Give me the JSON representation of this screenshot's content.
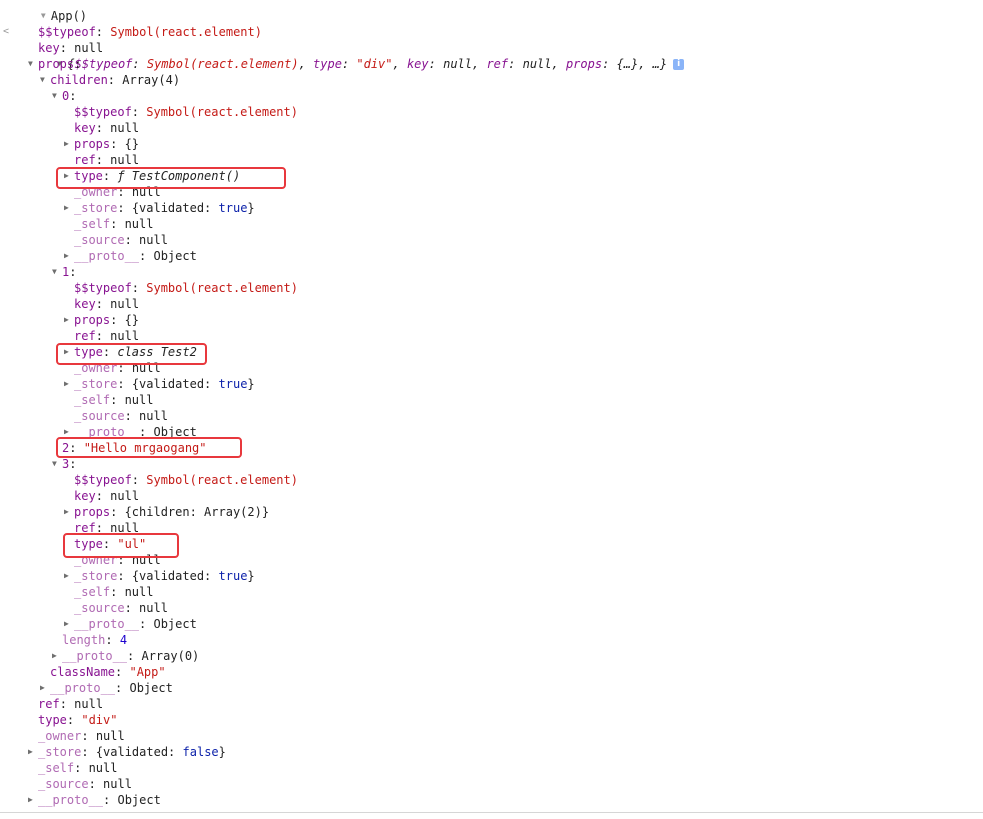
{
  "console": {
    "header_text": "App()",
    "summary": {
      "open": "{",
      "k1": "$$typeof",
      "v1": "Symbol(react.element)",
      "k2": "type",
      "v2": "\"div\"",
      "k3": "key",
      "v3": "null",
      "k4": "ref",
      "v4": "null",
      "k5": "props",
      "v5": "{…}",
      "tail": "…}"
    },
    "rows": [
      {
        "indent": 38,
        "tri": "",
        "k": "$$typeof",
        "parts": [
          {
            "c": "sym",
            "t": "Symbol(react.element)"
          }
        ]
      },
      {
        "indent": 38,
        "tri": "",
        "k": "key",
        "parts": [
          {
            "c": "plain",
            "t": "null"
          }
        ]
      },
      {
        "indent": 28,
        "tri": "down",
        "k": "props",
        "parts": []
      },
      {
        "indent": 40,
        "tri": "down",
        "k": "children",
        "parts": [
          {
            "c": "plain",
            "t": "Array(4)"
          }
        ]
      },
      {
        "indent": 52,
        "tri": "down",
        "k": "0",
        "parts": []
      },
      {
        "indent": 74,
        "tri": "",
        "k": "$$typeof",
        "parts": [
          {
            "c": "sym",
            "t": "Symbol(react.element)"
          }
        ]
      },
      {
        "indent": 74,
        "tri": "",
        "k": "key",
        "parts": [
          {
            "c": "plain",
            "t": "null"
          }
        ]
      },
      {
        "indent": 64,
        "tri": "right",
        "k": "props",
        "parts": [
          {
            "c": "plain",
            "t": "{}"
          }
        ]
      },
      {
        "indent": 74,
        "tri": "",
        "k": "ref",
        "parts": [
          {
            "c": "plain",
            "t": "null"
          }
        ]
      },
      {
        "indent": 64,
        "tri": "right",
        "k": "type",
        "parts": [
          {
            "c": "it",
            "t": "ƒ TestComponent()"
          }
        ]
      },
      {
        "indent": 74,
        "tri": "",
        "k": "_owner",
        "dim": true,
        "parts": [
          {
            "c": "plain",
            "t": "null"
          }
        ]
      },
      {
        "indent": 64,
        "tri": "right",
        "k": "_store",
        "dim": true,
        "parts": [
          {
            "c": "plain",
            "t": "{validated: "
          },
          {
            "c": "kw",
            "t": "true"
          },
          {
            "c": "plain",
            "t": "}"
          }
        ]
      },
      {
        "indent": 74,
        "tri": "",
        "k": "_self",
        "dim": true,
        "parts": [
          {
            "c": "plain",
            "t": "null"
          }
        ]
      },
      {
        "indent": 74,
        "tri": "",
        "k": "_source",
        "dim": true,
        "parts": [
          {
            "c": "plain",
            "t": "null"
          }
        ]
      },
      {
        "indent": 64,
        "tri": "right",
        "k": "__proto__",
        "dim": true,
        "parts": [
          {
            "c": "plain",
            "t": "Object"
          }
        ]
      },
      {
        "indent": 52,
        "tri": "down",
        "k": "1",
        "parts": []
      },
      {
        "indent": 74,
        "tri": "",
        "k": "$$typeof",
        "parts": [
          {
            "c": "sym",
            "t": "Symbol(react.element)"
          }
        ]
      },
      {
        "indent": 74,
        "tri": "",
        "k": "key",
        "parts": [
          {
            "c": "plain",
            "t": "null"
          }
        ]
      },
      {
        "indent": 64,
        "tri": "right",
        "k": "props",
        "parts": [
          {
            "c": "plain",
            "t": "{}"
          }
        ]
      },
      {
        "indent": 74,
        "tri": "",
        "k": "ref",
        "parts": [
          {
            "c": "plain",
            "t": "null"
          }
        ]
      },
      {
        "indent": 64,
        "tri": "right",
        "k": "type",
        "parts": [
          {
            "c": "it",
            "t": "class Test2"
          }
        ]
      },
      {
        "indent": 74,
        "tri": "",
        "k": "_owner",
        "dim": true,
        "parts": [
          {
            "c": "plain",
            "t": "null"
          }
        ]
      },
      {
        "indent": 64,
        "tri": "right",
        "k": "_store",
        "dim": true,
        "parts": [
          {
            "c": "plain",
            "t": "{validated: "
          },
          {
            "c": "kw",
            "t": "true"
          },
          {
            "c": "plain",
            "t": "}"
          }
        ]
      },
      {
        "indent": 74,
        "tri": "",
        "k": "_self",
        "dim": true,
        "parts": [
          {
            "c": "plain",
            "t": "null"
          }
        ]
      },
      {
        "indent": 74,
        "tri": "",
        "k": "_source",
        "dim": true,
        "parts": [
          {
            "c": "plain",
            "t": "null"
          }
        ]
      },
      {
        "indent": 64,
        "tri": "right",
        "k": "__proto__",
        "dim": true,
        "parts": [
          {
            "c": "plain",
            "t": "Object"
          }
        ]
      },
      {
        "indent": 62,
        "tri": "",
        "k": "2",
        "parts": [
          {
            "c": "str",
            "t": "\"Hello mrgaogang\""
          }
        ]
      },
      {
        "indent": 52,
        "tri": "down",
        "k": "3",
        "parts": []
      },
      {
        "indent": 74,
        "tri": "",
        "k": "$$typeof",
        "parts": [
          {
            "c": "sym",
            "t": "Symbol(react.element)"
          }
        ]
      },
      {
        "indent": 74,
        "tri": "",
        "k": "key",
        "parts": [
          {
            "c": "plain",
            "t": "null"
          }
        ]
      },
      {
        "indent": 64,
        "tri": "right",
        "k": "props",
        "parts": [
          {
            "c": "plain",
            "t": "{children: Array(2)}"
          }
        ]
      },
      {
        "indent": 74,
        "tri": "",
        "k": "ref",
        "parts": [
          {
            "c": "plain",
            "t": "null"
          }
        ]
      },
      {
        "indent": 74,
        "tri": "",
        "k": "type",
        "parts": [
          {
            "c": "str",
            "t": "\"ul\""
          }
        ]
      },
      {
        "indent": 74,
        "tri": "",
        "k": "_owner",
        "dim": true,
        "parts": [
          {
            "c": "plain",
            "t": "null"
          }
        ]
      },
      {
        "indent": 64,
        "tri": "right",
        "k": "_store",
        "dim": true,
        "parts": [
          {
            "c": "plain",
            "t": "{validated: "
          },
          {
            "c": "kw",
            "t": "true"
          },
          {
            "c": "plain",
            "t": "}"
          }
        ]
      },
      {
        "indent": 74,
        "tri": "",
        "k": "_self",
        "dim": true,
        "parts": [
          {
            "c": "plain",
            "t": "null"
          }
        ]
      },
      {
        "indent": 74,
        "tri": "",
        "k": "_source",
        "dim": true,
        "parts": [
          {
            "c": "plain",
            "t": "null"
          }
        ]
      },
      {
        "indent": 64,
        "tri": "right",
        "k": "__proto__",
        "dim": true,
        "parts": [
          {
            "c": "plain",
            "t": "Object"
          }
        ]
      },
      {
        "indent": 62,
        "tri": "",
        "k": "length",
        "dim": true,
        "parts": [
          {
            "c": "num",
            "t": "4"
          }
        ]
      },
      {
        "indent": 52,
        "tri": "right",
        "k": "__proto__",
        "dim": true,
        "parts": [
          {
            "c": "plain",
            "t": "Array(0)"
          }
        ]
      },
      {
        "indent": 50,
        "tri": "",
        "k": "className",
        "parts": [
          {
            "c": "str",
            "t": "\"App\""
          }
        ]
      },
      {
        "indent": 40,
        "tri": "right",
        "k": "__proto__",
        "dim": true,
        "parts": [
          {
            "c": "plain",
            "t": "Object"
          }
        ]
      },
      {
        "indent": 38,
        "tri": "",
        "k": "ref",
        "parts": [
          {
            "c": "plain",
            "t": "null"
          }
        ]
      },
      {
        "indent": 38,
        "tri": "",
        "k": "type",
        "parts": [
          {
            "c": "str",
            "t": "\"div\""
          }
        ]
      },
      {
        "indent": 38,
        "tri": "",
        "k": "_owner",
        "dim": true,
        "parts": [
          {
            "c": "plain",
            "t": "null"
          }
        ]
      },
      {
        "indent": 28,
        "tri": "right",
        "k": "_store",
        "dim": true,
        "parts": [
          {
            "c": "plain",
            "t": "{validated: "
          },
          {
            "c": "kw",
            "t": "false"
          },
          {
            "c": "plain",
            "t": "}"
          }
        ]
      },
      {
        "indent": 38,
        "tri": "",
        "k": "_self",
        "dim": true,
        "parts": [
          {
            "c": "plain",
            "t": "null"
          }
        ]
      },
      {
        "indent": 38,
        "tri": "",
        "k": "_source",
        "dim": true,
        "parts": [
          {
            "c": "plain",
            "t": "null"
          }
        ]
      },
      {
        "indent": 28,
        "tri": "right",
        "k": "__proto__",
        "dim": true,
        "parts": [
          {
            "c": "plain",
            "t": "Object"
          }
        ]
      }
    ]
  },
  "icons": {
    "info": "i",
    "triangle_down": "▼",
    "triangle_right": "▶",
    "prompt_arrow": "<"
  },
  "colors": {
    "key": "#881391",
    "string": "#c41a16",
    "keyword": "#0d22aa",
    "number": "#1c00cf",
    "highlight": "#e8383d"
  }
}
